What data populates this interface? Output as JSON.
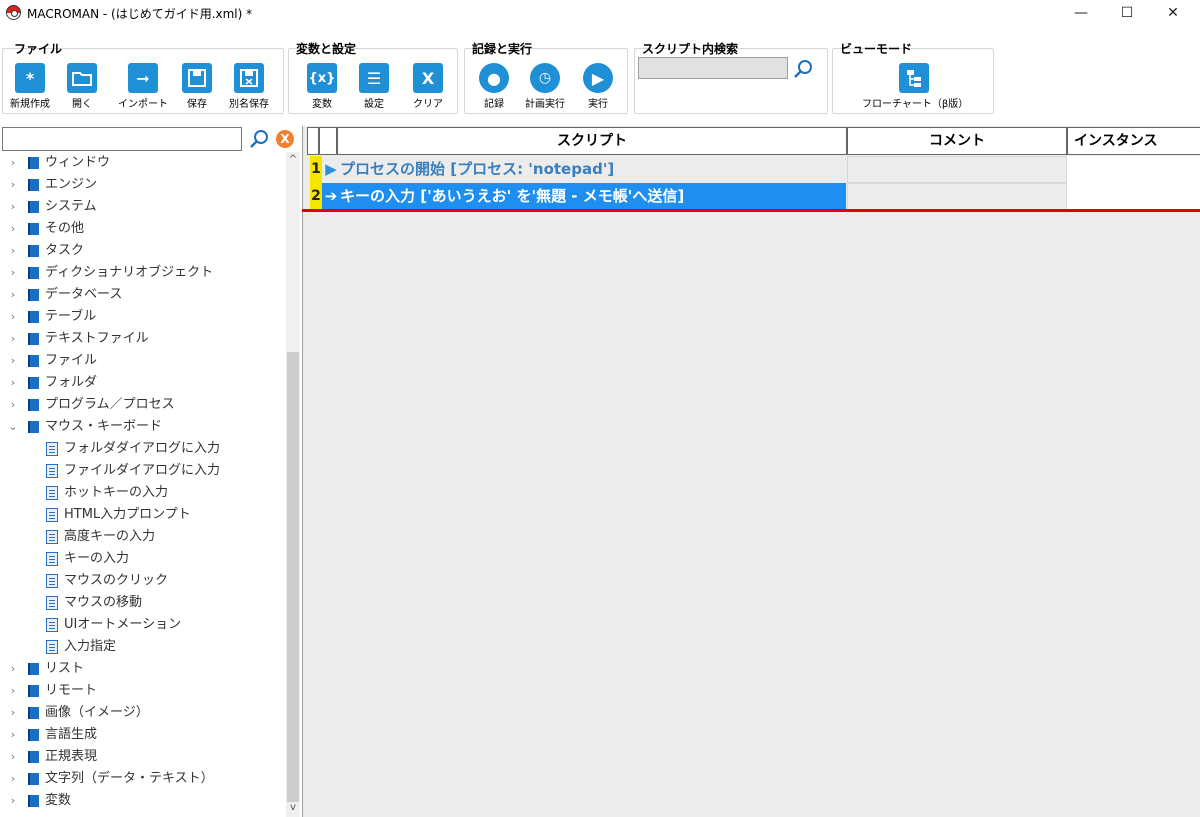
{
  "window": {
    "title": "MACROMAN - (はじめてガイド用.xml) *",
    "minimize": "—",
    "maximize": "☐",
    "close": "✕"
  },
  "ribbon": {
    "file": {
      "title": "ファイル",
      "new": "新規作成",
      "open": "開く",
      "import": "インポート",
      "save": "保存",
      "save_as": "別名保存"
    },
    "vars": {
      "title": "変数と設定",
      "variables": "変数",
      "settings": "設定",
      "clear": "クリア"
    },
    "record": {
      "title": "記録と実行",
      "record": "記録",
      "scheduled": "計画実行",
      "run": "実行"
    },
    "search": {
      "title": "スクリプト内検索",
      "value": ""
    },
    "view": {
      "title": "ビューモード",
      "flowchart": "フローチャート（β版）"
    }
  },
  "tree": {
    "search_value": "",
    "items": [
      {
        "label": "ウィンドウ"
      },
      {
        "label": "エンジン"
      },
      {
        "label": "システム"
      },
      {
        "label": "その他"
      },
      {
        "label": "タスク"
      },
      {
        "label": "ディクショナリオブジェクト"
      },
      {
        "label": "データベース"
      },
      {
        "label": "テーブル"
      },
      {
        "label": "テキストファイル"
      },
      {
        "label": "ファイル"
      },
      {
        "label": "フォルダ"
      },
      {
        "label": "プログラム／プロセス"
      },
      {
        "label": "マウス・キーボード"
      }
    ],
    "children": [
      {
        "label": "フォルダダイアログに入力"
      },
      {
        "label": "ファイルダイアログに入力"
      },
      {
        "label": "ホットキーの入力"
      },
      {
        "label": "HTML入力プロンプト"
      },
      {
        "label": "高度キーの入力"
      },
      {
        "label": "キーの入力"
      },
      {
        "label": "マウスのクリック"
      },
      {
        "label": "マウスの移動"
      },
      {
        "label": "UIオートメーション"
      },
      {
        "label": "入力指定"
      }
    ],
    "items_after": [
      {
        "label": "リスト"
      },
      {
        "label": "リモート"
      },
      {
        "label": "画像（イメージ）"
      },
      {
        "label": "言語生成"
      },
      {
        "label": "正規表現"
      },
      {
        "label": "文字列（データ・テキスト）"
      },
      {
        "label": "変数"
      }
    ]
  },
  "grid": {
    "headers": {
      "script": "スクリプト",
      "comment": "コメント",
      "instance": "インスタンス"
    },
    "rows": [
      {
        "num": "1",
        "icon": "▶",
        "text": "プロセスの開始 [プロセス: 'notepad']",
        "selected": false
      },
      {
        "num": "2",
        "icon": "➔",
        "text": "キーの入力 ['あいうえお' を'無題 - メモ帳'へ送信]",
        "selected": true
      }
    ]
  },
  "colors": {
    "accent": "#1f8fd6",
    "selected_row": "#1e8ff0",
    "row_number_bg": "#f5e500",
    "marker": "#e00000"
  }
}
